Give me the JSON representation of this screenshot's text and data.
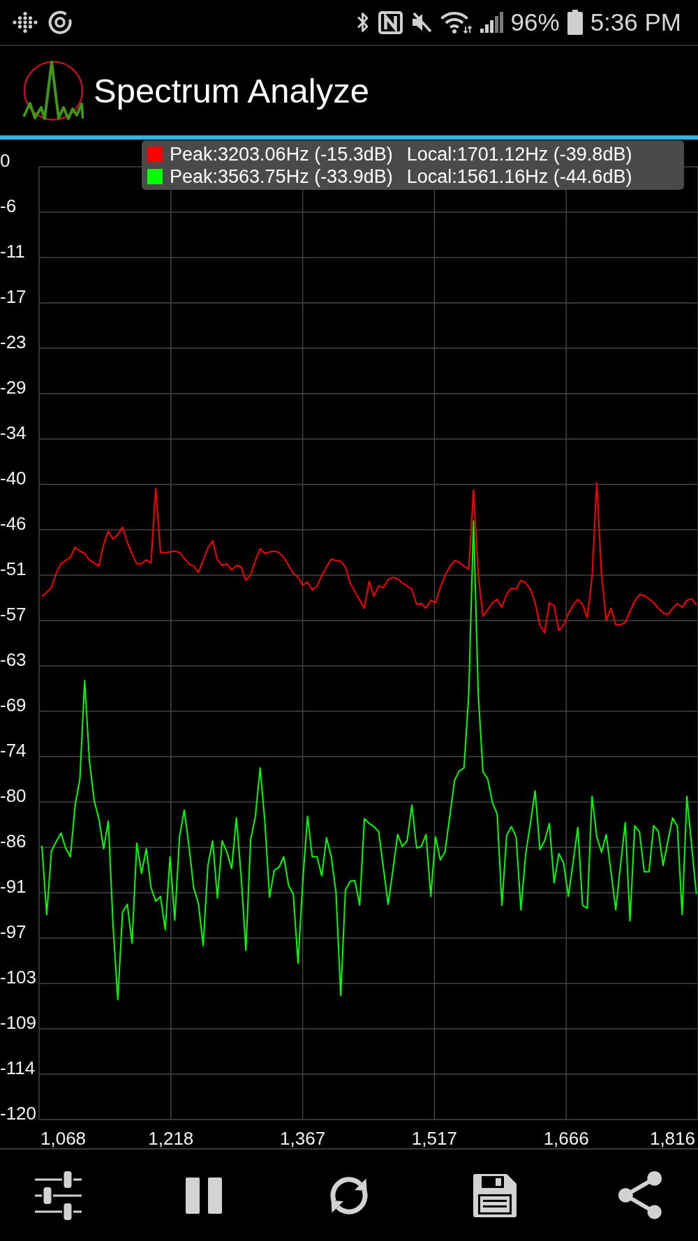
{
  "status_bar": {
    "battery": "96%",
    "time": "5:36 PM"
  },
  "app_bar": {
    "title": "Spectrum Analyze"
  },
  "spectrum": {
    "legend": [
      {
        "color": "#ff0000",
        "peak": "Peak:3203.06Hz (-15.3dB)",
        "local": "Local:1701.12Hz (-39.8dB)"
      },
      {
        "color": "#00ff00",
        "peak": "Peak:3563.75Hz (-33.9dB)",
        "local": "Local:1561.16Hz (-44.6dB)"
      }
    ],
    "chart_data": {
      "type": "line",
      "grid": true,
      "xlim": [
        1068,
        1816
      ],
      "ylim": [
        -120,
        0
      ],
      "xticks": [
        {
          "value": 1068,
          "label": "1,068"
        },
        {
          "value": 1217.6,
          "label": "1,218"
        },
        {
          "value": 1367.2,
          "label": "1,367"
        },
        {
          "value": 1516.8,
          "label": "1,517"
        },
        {
          "value": 1666.4,
          "label": "1,666"
        },
        {
          "value": 1816,
          "label": "1,816"
        }
      ],
      "yticks": [
        {
          "value": 0,
          "label": "0"
        },
        {
          "value": -5.71,
          "label": "-6"
        },
        {
          "value": -11.43,
          "label": "-11"
        },
        {
          "value": -17.14,
          "label": "-17"
        },
        {
          "value": -22.86,
          "label": "-23"
        },
        {
          "value": -28.57,
          "label": "-29"
        },
        {
          "value": -34.29,
          "label": "-34"
        },
        {
          "value": -40,
          "label": "-40"
        },
        {
          "value": -45.71,
          "label": "-46"
        },
        {
          "value": -51.43,
          "label": "-51"
        },
        {
          "value": -57.14,
          "label": "-57"
        },
        {
          "value": -62.86,
          "label": "-63"
        },
        {
          "value": -68.57,
          "label": "-69"
        },
        {
          "value": -74.29,
          "label": "-74"
        },
        {
          "value": -80,
          "label": "-80"
        },
        {
          "value": -85.71,
          "label": "-86"
        },
        {
          "value": -91.43,
          "label": "-91"
        },
        {
          "value": -97.14,
          "label": "-97"
        },
        {
          "value": -102.86,
          "label": "-103"
        },
        {
          "value": -108.57,
          "label": "-109"
        },
        {
          "value": -114.29,
          "label": "-114"
        },
        {
          "value": -120,
          "label": "-120"
        }
      ],
      "x": [
        1071.28,
        1076.66,
        1082.04,
        1087.43,
        1092.81,
        1098.19,
        1103.58,
        1108.96,
        1114.34,
        1119.73,
        1125.11,
        1130.49,
        1135.88,
        1141.26,
        1146.64,
        1152.03,
        1157.41,
        1162.79,
        1168.18,
        1173.56,
        1178.94,
        1184.33,
        1189.71,
        1195.09,
        1200.48,
        1205.86,
        1211.24,
        1216.63,
        1222.01,
        1227.39,
        1232.78,
        1238.16,
        1243.54,
        1248.93,
        1254.31,
        1259.69,
        1265.08,
        1270.46,
        1275.84,
        1281.23,
        1286.61,
        1291.99,
        1297.38,
        1302.76,
        1308.14,
        1313.53,
        1318.91,
        1324.29,
        1329.68,
        1335.06,
        1340.44,
        1345.83,
        1351.21,
        1356.59,
        1361.98,
        1367.36,
        1372.74,
        1378.13,
        1383.51,
        1388.89,
        1394.28,
        1399.66,
        1405.04,
        1410.43,
        1415.81,
        1421.19,
        1426.57,
        1431.96,
        1437.34,
        1442.72,
        1448.11,
        1453.49,
        1458.87,
        1464.26,
        1469.64,
        1475.02,
        1480.41,
        1485.79,
        1491.17,
        1496.56,
        1501.94,
        1507.32,
        1512.71,
        1518.09,
        1523.47,
        1528.86,
        1534.24,
        1539.62,
        1545.01,
        1550.39,
        1555.77,
        1561.16,
        1566.54,
        1571.92,
        1577.31,
        1582.69,
        1588.07,
        1593.46,
        1598.84,
        1604.22,
        1609.61,
        1614.99,
        1620.37,
        1625.76,
        1631.14,
        1636.52,
        1641.91,
        1647.29,
        1652.67,
        1658.06,
        1663.44,
        1668.82,
        1674.21,
        1679.59,
        1684.97,
        1690.36,
        1695.74,
        1701.12,
        1706.51,
        1711.89,
        1717.27,
        1722.66,
        1728.04,
        1733.42,
        1738.81,
        1744.19,
        1749.57,
        1754.96,
        1760.34,
        1765.72,
        1771.11,
        1776.49,
        1781.87,
        1787.26,
        1792.64,
        1798.02,
        1803.41,
        1808.79,
        1814.17
      ],
      "series": [
        {
          "color": "#ff0000",
          "values": [
            -54.1,
            -53.6,
            -53.0,
            -51.2,
            -50.0,
            -49.6,
            -49.2,
            -47.9,
            -48.4,
            -48.7,
            -49.5,
            -49.9,
            -50.3,
            -47.6,
            -45.9,
            -46.9,
            -46.3,
            -45.4,
            -47.3,
            -48.7,
            -50.0,
            -50.0,
            -49.5,
            -49.9,
            -40.5,
            -48.6,
            -48.6,
            -48.5,
            -48.4,
            -48.6,
            -49.3,
            -50.0,
            -50.3,
            -51.1,
            -49.6,
            -48.0,
            -47.1,
            -49.5,
            -50.2,
            -50.0,
            -50.8,
            -50.2,
            -50.4,
            -52.1,
            -51.4,
            -49.6,
            -48.1,
            -48.7,
            -48.5,
            -48.4,
            -48.6,
            -49.2,
            -50.2,
            -51.2,
            -51.7,
            -52.7,
            -52.3,
            -53.3,
            -52.8,
            -51.5,
            -50.4,
            -49.4,
            -49.6,
            -49.7,
            -50.4,
            -52.4,
            -53.5,
            -54.6,
            -55.6,
            -52.2,
            -54.1,
            -52.8,
            -53.0,
            -52.0,
            -51.7,
            -51.9,
            -52.4,
            -52.8,
            -53.2,
            -55.1,
            -55.0,
            -55.6,
            -54.6,
            -54.9,
            -53.0,
            -51.5,
            -50.4,
            -49.6,
            -49.8,
            -50.3,
            -50.7,
            -40.7,
            -51.3,
            -56.6,
            -55.8,
            -54.9,
            -54.5,
            -55.5,
            -53.8,
            -53.1,
            -53.2,
            -52.1,
            -52.4,
            -53.2,
            -54.9,
            -57.7,
            -58.7,
            -54.9,
            -55.3,
            -58.4,
            -57.7,
            -56.3,
            -55.2,
            -54.5,
            -55.1,
            -56.8,
            -51.8,
            -39.8,
            -51.3,
            -57.2,
            -55.6,
            -57.7,
            -57.7,
            -57.4,
            -56.0,
            -54.7,
            -53.9,
            -54.0,
            -54.4,
            -54.9,
            -55.6,
            -56.2,
            -56.4,
            -55.6,
            -55.0,
            -55.5,
            -54.6,
            -54.4,
            -55.2
          ]
        },
        {
          "color": "#00ff00",
          "values": [
            -85.5,
            -94.2,
            -86.2,
            -85.0,
            -83.9,
            -85.8,
            -86.9,
            -80.4,
            -77.1,
            -64.7,
            -74.8,
            -79.8,
            -82.1,
            -85.9,
            -82.4,
            -95.6,
            -104.9,
            -93.9,
            -92.9,
            -97.8,
            -85.2,
            -89.0,
            -85.9,
            -90.8,
            -92.5,
            -91.9,
            -96.1,
            -86.9,
            -94.9,
            -84.4,
            -81.0,
            -85.5,
            -90.8,
            -92.8,
            -98.1,
            -88.0,
            -84.9,
            -92.1,
            -84.9,
            -86.3,
            -88.4,
            -82.0,
            -89.4,
            -98.7,
            -84.8,
            -81.8,
            -75.7,
            -82.4,
            -92.0,
            -88.6,
            -88.2,
            -86.9,
            -90.5,
            -91.6,
            -100.3,
            -90.0,
            -81.8,
            -86.9,
            -86.9,
            -89.3,
            -84.5,
            -86.9,
            -91.4,
            -104.4,
            -91.1,
            -90.0,
            -89.9,
            -93.0,
            -82.1,
            -82.7,
            -83.1,
            -83.7,
            -88.3,
            -92.9,
            -88.6,
            -84.1,
            -85.6,
            -84.9,
            -80.4,
            -85.8,
            -85.6,
            -84.1,
            -91.9,
            -84.4,
            -87.3,
            -86.3,
            -81.8,
            -77.3,
            -76.1,
            -75.7,
            -66.4,
            -44.6,
            -66.4,
            -76.2,
            -77.1,
            -80.1,
            -81.5,
            -93.0,
            -84.2,
            -83.1,
            -84.4,
            -93.6,
            -86.6,
            -82.7,
            -78.6,
            -86.0,
            -84.9,
            -82.7,
            -90.2,
            -86.5,
            -87.7,
            -91.9,
            -87.6,
            -83.2,
            -93.0,
            -93.4,
            -79.3,
            -84.4,
            -86.3,
            -84.1,
            -88.8,
            -93.6,
            -88.0,
            -82.6,
            -95.0,
            -83.0,
            -83.8,
            -88.8,
            -88.8,
            -83.0,
            -83.7,
            -88.0,
            -84.9,
            -82.0,
            -83.1,
            -94.2,
            -79.3,
            -85.5,
            -91.6
          ]
        }
      ]
    }
  }
}
